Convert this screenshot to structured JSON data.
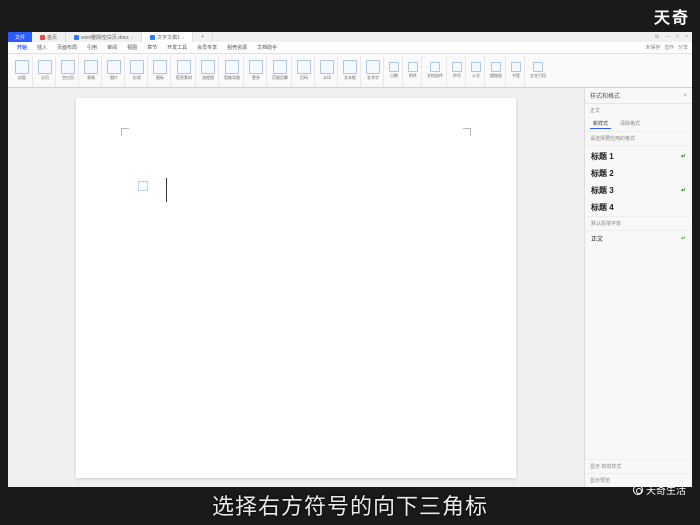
{
  "watermark": {
    "top": "天奇",
    "bottom": "天奇生活"
  },
  "subtitle": "选择右方符号的向下三角标",
  "window": {
    "app_btn": "文件",
    "tabs": [
      {
        "icon_color": "#e74c3c",
        "label": "首页"
      },
      {
        "icon_color": "#2a7cff",
        "label": "word删除空白页.docx"
      },
      {
        "icon_color": "#2a7cff",
        "label": "文字文稿1"
      }
    ],
    "top_right": [
      "⊞",
      "—",
      "□",
      "×"
    ]
  },
  "menu": {
    "items": [
      "开始",
      "插入",
      "页面布局",
      "引用",
      "审阅",
      "视图",
      "章节",
      "开发工具",
      "会员专享",
      "稻壳资源",
      "文档助手"
    ],
    "right": [
      "未保存",
      "협作",
      "分享"
    ]
  },
  "ribbon": {
    "groups": [
      {
        "label": "封面",
        "sub": ""
      },
      {
        "label": "分页",
        "sub": ""
      },
      {
        "label": "空白页",
        "sub": ""
      },
      {
        "label": "表格",
        "sub": ""
      },
      {
        "label": "图片",
        "sub": ""
      },
      {
        "label": "形状",
        "sub": ""
      },
      {
        "label": "图标",
        "sub": ""
      },
      {
        "label": "稻壳素材",
        "sub": ""
      },
      {
        "label": "流程图",
        "sub": ""
      },
      {
        "label": "思维导图",
        "sub": ""
      },
      {
        "label": "更多",
        "sub": ""
      },
      {
        "label": "页眉页脚",
        "sub": ""
      },
      {
        "label": "页码",
        "sub": ""
      },
      {
        "label": "水印",
        "sub": ""
      },
      {
        "label": "文本框",
        "sub": ""
      },
      {
        "label": "艺术字",
        "sub": ""
      },
      {
        "label": "日期",
        "sub": ""
      },
      {
        "label": "附件",
        "sub": ""
      },
      {
        "label": "文档部件",
        "sub": ""
      },
      {
        "label": "符号",
        "sub": ""
      },
      {
        "label": "公式",
        "sub": ""
      },
      {
        "label": "超链接",
        "sub": ""
      },
      {
        "label": "书签",
        "sub": ""
      },
      {
        "label": "交叉引用",
        "sub": ""
      }
    ]
  },
  "panel": {
    "title": "样式和格式",
    "current": "正文",
    "tabs": [
      "新样式",
      "清除格式"
    ],
    "section": "请选择要应用的格式",
    "styles": [
      {
        "name": "标题 1",
        "checked": true
      },
      {
        "name": "标题 2",
        "checked": false
      },
      {
        "name": "标题 3",
        "checked": true
      },
      {
        "name": "标题 4",
        "checked": false
      }
    ],
    "default_item": "默认段落字体",
    "normal": "正文",
    "footer1": "显示 有效样式",
    "footer2": "显示预览"
  }
}
